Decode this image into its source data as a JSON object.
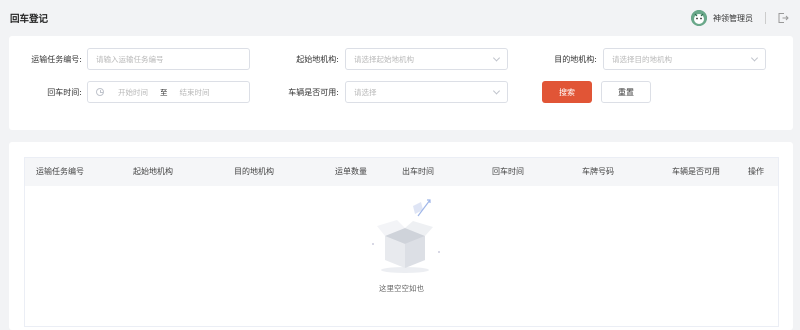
{
  "header": {
    "title": "回车登记",
    "user_name": "神领管理员"
  },
  "filters": {
    "task_no_label": "运输任务编号:",
    "task_no_placeholder": "请输入运输任务编号",
    "start_org_label": "起始地机构:",
    "start_org_placeholder": "请选择起始地机构",
    "dest_org_label": "目的地机构:",
    "dest_org_placeholder": "请选择目的地机构",
    "return_time_label": "回车时间:",
    "start_time_placeholder": "开始时间",
    "range_sep": "至",
    "end_time_placeholder": "结束时间",
    "available_label": "车辆是否可用:",
    "available_placeholder": "请选择",
    "search_label": "搜索",
    "reset_label": "重置"
  },
  "table": {
    "columns": [
      "运输任务编号",
      "起始地机构",
      "目的地机构",
      "运单数量",
      "出车时间",
      "回车时间",
      "车牌号码",
      "车辆是否可用",
      "操作"
    ],
    "empty_text": "这里空空如也"
  },
  "colors": {
    "primary": "#e15536",
    "background": "#f2f3f5"
  }
}
